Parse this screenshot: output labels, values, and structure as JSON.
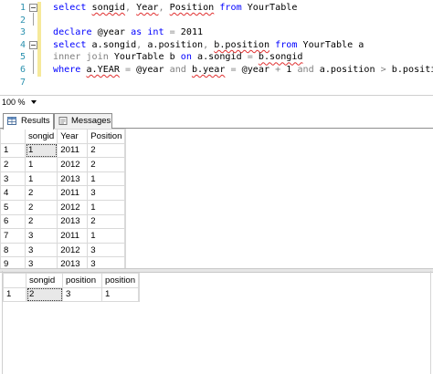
{
  "editor": {
    "line_numbers": [
      "1",
      "2",
      "3",
      "4",
      "5",
      "6",
      "7"
    ],
    "line1": {
      "select": "select",
      "songid": "songid",
      "c1": ",",
      "year": "Year",
      "c2": ",",
      "position": "Position",
      "from": "from",
      "table": "YourTable"
    },
    "line3": {
      "declare": "declare",
      "var": "@year",
      "as": "as",
      "int": "int",
      "eq": "=",
      "val": "2011"
    },
    "line4": {
      "select": "select",
      "a_songid": "a.songid",
      "c1": ",",
      "a_position": "a.position",
      "c2": ",",
      "b_position": "b.position",
      "from": "from",
      "table": "YourTable",
      "alias": "a"
    },
    "line5": {
      "inner": "inner",
      "join": "join",
      "table": "YourTable",
      "alias": "b",
      "on": "on",
      "a_songid": "a.songid",
      "eq": "=",
      "b_songid": "b.songid"
    },
    "line6": {
      "where": "where",
      "a_year": "a.YEAR",
      "eq1": "=",
      "var1": "@year",
      "and1": "and",
      "b_year": "b.year",
      "eq2": "=",
      "var2": "@year",
      "plus": "+",
      "one": "1",
      "and2": "and",
      "a_position": "a.position",
      "gt": ">",
      "b_position": "b.position"
    }
  },
  "zoom": "100 %",
  "tabs": {
    "results": "Results",
    "messages": "Messages"
  },
  "result1": {
    "columns": [
      "songid",
      "Year",
      "Position"
    ],
    "rows": [
      [
        "1",
        "1",
        "2011",
        "2"
      ],
      [
        "2",
        "1",
        "2012",
        "2"
      ],
      [
        "3",
        "1",
        "2013",
        "1"
      ],
      [
        "4",
        "2",
        "2011",
        "3"
      ],
      [
        "5",
        "2",
        "2012",
        "1"
      ],
      [
        "6",
        "2",
        "2013",
        "2"
      ],
      [
        "7",
        "3",
        "2011",
        "1"
      ],
      [
        "8",
        "3",
        "2012",
        "3"
      ],
      [
        "9",
        "3",
        "2013",
        "3"
      ]
    ]
  },
  "result2": {
    "columns": [
      "songid",
      "position",
      "position"
    ],
    "rows": [
      [
        "1",
        "2",
        "3",
        "1"
      ]
    ]
  }
}
